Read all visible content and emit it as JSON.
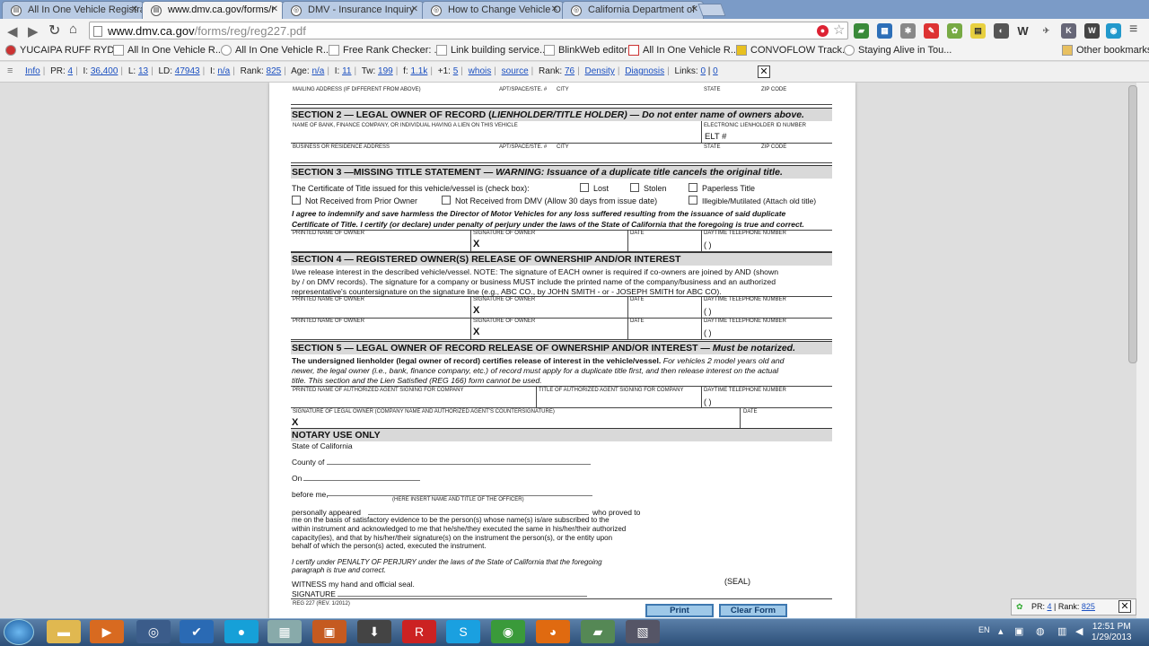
{
  "tabs": [
    {
      "label": "All In One Vehicle Registra"
    },
    {
      "label": "www.dmv.ca.gov/forms/r"
    },
    {
      "label": "DMV - Insurance Inquiry"
    },
    {
      "label": "How to Change Vehicle O"
    },
    {
      "label": "California Department of"
    }
  ],
  "address": {
    "domain": "www.dmv.ca.gov",
    "path": "/forms/reg/reg227.pdf"
  },
  "bookmarks": [
    "YUCAIPA RUFF RYD...",
    "All In One Vehicle R...",
    "All In One Vehicle R...",
    "Free Rank Checker: ...",
    "Link building service...",
    "BlinkWeb editor",
    "All In One Vehicle R...",
    "CONVOFLOW Track...",
    "Staying Alive in Tou...",
    "Other bookmarks"
  ],
  "seo": {
    "info": "Info",
    "pr_label": "PR:",
    "pr": "4",
    "i_label": "I:",
    "i": "36,400",
    "l_label": "L:",
    "l": "13",
    "ld_label": "LD:",
    "ld": "47943",
    "i2_label": "I:",
    "i2": "n/a",
    "rank_label": "Rank:",
    "rank": "825",
    "age_label": "Age:",
    "age": "n/a",
    "i3_label": "I:",
    "i3": "11",
    "tw_label": "Tw:",
    "tw": "199",
    "f_label": "f:",
    "f": "1.1k",
    "g_label": "+1:",
    "g": "5",
    "whois": "whois",
    "source": "source",
    "rank2_label": "Rank:",
    "rank2": "76",
    "density": "Density",
    "diagnosis": "Diagnosis",
    "links_label": "Links:",
    "links_a": "0",
    "links_b": "0"
  },
  "form": {
    "mailing": "MAILING ADDRESS (IF DIFFERENT FROM ABOVE)",
    "apt": "APT/SPACE/STE. #",
    "city": "CITY",
    "state": "STATE",
    "zip": "ZIP CODE",
    "s2_title": "SECTION 2 — LEGAL OWNER OF RECORD (",
    "s2_italic": "LIENHOLDER/TITLE HOLDER",
    "s2_tail": ") — Do not enter name of owners above.",
    "s2_bank": "NAME OF BANK, FINANCE COMPANY, OR INDIVIDUAL HAVING A LIEN ON THIS VEHICLE",
    "s2_elt_head": "ELECTRONIC LIENHOLDER ID NUMBER",
    "s2_elt": "ELT #",
    "s2_business": "BUSINESS OR RESIDENCE ADDRESS",
    "s3_title": "SECTION 3 —MISSING TITLE STATEMENT — ",
    "s3_warn": "WARNING: Issuance of a duplicate title cancels the original title.",
    "s3_cert": "The Certificate of Title issued for this vehicle/vessel is (check box):",
    "lost": "Lost",
    "stolen": "Stolen",
    "paperless": "Paperless Title",
    "not_prior": "Not Received from Prior Owner",
    "not_dmv": "Not Received from DMV (Allow 30 days from issue date)",
    "illegible": "Illegible/Mutilated (Attach old title)",
    "s3_agree1": "I agree to indemnify and save harmless the Director of Motor Vehicles for any loss suffered resulting from the issuance of said duplicate",
    "s3_agree2": "Certificate of Title. I certify (or declare) under penalty of perjury under the laws of the State of California that the foregoing is true and correct.",
    "printed_name": "PRINTED NAME OF OWNER",
    "signature": "SIGNATURE OF OWNER",
    "date": "DATE",
    "phone": "DAYTIME TELEPHONE NUMBER",
    "x": "X",
    "paren": "(        )",
    "s4_title": "SECTION 4 — REGISTERED OWNER(S) RELEASE OF OWNERSHIP AND/OR INTEREST",
    "s4_l1": "I/we release interest in the described vehicle/vessel. NOTE: The signature of EACH owner is required if co-owners are joined by AND (shown",
    "s4_l2": "by / on DMV records). The signature for a company or business MUST include the printed name of the company/business and an authorized",
    "s4_l3": "representative's countersignature on the signature line (e.g., ABC CO., by JOHN SMITH - or - JOSEPH SMITH for ABC CO).",
    "s5_title": "SECTION 5 — LEGAL OWNER OF RECORD RELEASE OF OWNERSHIP AND/OR INTEREST — ",
    "s5_tail": "Must be notarized.",
    "s5_l1a": "The undersigned lienholder (legal owner of record) certifies release of interest in the vehicle/vessel.",
    "s5_l1b": " For vehicles 2 model years old and",
    "s5_l2": "newer, the legal owner (i.e., bank, finance company, etc.) of record must apply for a duplicate title first, and then release interest on the actual",
    "s5_l3": "title. This section and the Lien Satisfied (REG 166) form cannot be used.",
    "s5_agent": "PRINTED NAME OF AUTHORIZED AGENT SIGNING FOR COMPANY",
    "s5_title_agent": "TITLE OF AUTHORIZED AGENT SIGNING FOR COMPANY",
    "s5_sig": "SIGNATURE OF LEGAL OWNER (COMPANY NAME AND AUTHORIZED AGENT'S COUNTERSIGNATURE)",
    "notary": "NOTARY USE ONLY",
    "state_ca": "State of California",
    "county": "County of",
    "on": "On",
    "before": "before me,",
    "officer": "(HERE INSERT NAME AND TITLE OF THE OFFICER)",
    "appeared": "personally appeared",
    "proved": "who proved to",
    "n1": "me on the basis of satisfactory evidence to be the person(s) whose name(s) is/are subscribed to the",
    "n2": "within instrument and acknowledged to me that he/she/they executed the same in his/her/their authorized",
    "n3": "capacity(ies), and that by his/her/their signature(s) on the instrument the person(s), or the entity upon",
    "n4": "behalf of which the person(s) acted, executed the instrument.",
    "perj1": "I certify under PENALTY OF PERJURY under the laws of the State of California that the foregoing",
    "perj2": "paragraph is true and correct.",
    "witness": "WITNESS my hand and official seal.",
    "sig_label": "SIGNATURE",
    "seal": "(SEAL)",
    "rev": "REG 227 (REV. 1/2012)",
    "print": "Print",
    "clear": "Clear Form"
  },
  "float_bar": {
    "pr_label": "PR:",
    "pr": "4",
    "rank_label": "Rank:",
    "rank": "825"
  },
  "tray": {
    "lang": "EN",
    "time": "12:51 PM",
    "date": "1/29/2013"
  }
}
